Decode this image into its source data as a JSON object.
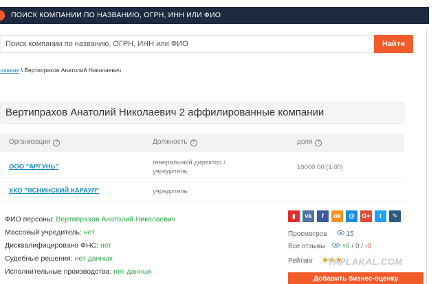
{
  "header": {
    "title": "ПОИСК КОМПАНИИ ПО НАЗВАНИЮ, ОГРН, ИНН ИЛИ ФИО"
  },
  "search": {
    "placeholder": "Поиск компании по названию, ОГРН, ИНН или ФИО",
    "button_label": "Найти"
  },
  "breadcrumb": {
    "home": "лавная",
    "separator": " \\ ",
    "current": "Вертипрахов Анатолий Николаевич"
  },
  "heading": "Вертипрахов Анатолий Николаевич 2 аффилированные компании",
  "table": {
    "headers": [
      "Организация",
      "Должность",
      "доля"
    ],
    "rows": [
      {
        "org": "ООО \"АРГУНЬ\"",
        "role_line1": "генеральный директор /",
        "role_line2": "учредитель",
        "share": "10000.00 (1.00)"
      },
      {
        "org": "ХКО \"ЯСНИНСКИЙ КАРАУЛ\"",
        "role_line1": "учредитель",
        "role_line2": "",
        "share": ""
      }
    ]
  },
  "person": {
    "fio_label": "ФИО персоны: ",
    "fio_value": "Вертипрахов Анатолий Николаевич",
    "mass_label": "Массовый учредитель: ",
    "mass_value": "нет",
    "disq_label": "Дисквалифицировано ФНС: ",
    "disq_value": "нет",
    "court_label": "Судебные решения: ",
    "court_value": "нет данных",
    "exec_label": "Исполнительные производства: ",
    "exec_value": "нет данных"
  },
  "social": [
    {
      "name": "bookmark-icon",
      "glyph": "▮",
      "color": "#e12d2d"
    },
    {
      "name": "vk-icon",
      "glyph": "vk",
      "color": "#4c75a3"
    },
    {
      "name": "facebook-icon",
      "glyph": "f",
      "color": "#3b5998"
    },
    {
      "name": "odnoklassniki-icon",
      "glyph": "ok",
      "color": "#f7931e"
    },
    {
      "name": "mailru-icon",
      "glyph": "@",
      "color": "#168de2"
    },
    {
      "name": "googleplus-icon",
      "glyph": "G+",
      "color": "#dd4b39"
    },
    {
      "name": "twitter-icon",
      "glyph": "t",
      "color": "#1da1f2"
    },
    {
      "name": "livejournal-icon",
      "glyph": "✎",
      "color": "#2b5a81"
    }
  ],
  "stats": {
    "views_label": "Просмотров",
    "views_value": "15",
    "reviews_label": "Все отзывы",
    "reviews_pos": "+0",
    "reviews_sep1": " / ",
    "reviews_neu": "0",
    "reviews_sep2": " / ",
    "reviews_neg": "-0",
    "rating_label": "Рейтинг",
    "rating_stars": "★★★"
  },
  "watermark": "YAPLAKAL.COM",
  "cta_label": "Добавить бизнес-оценку",
  "colors": {
    "accent": "#f15a29",
    "header_bg": "#1e2a3f",
    "link": "#1a86c4",
    "positive": "#27a844",
    "negative": "#e64a3c"
  }
}
